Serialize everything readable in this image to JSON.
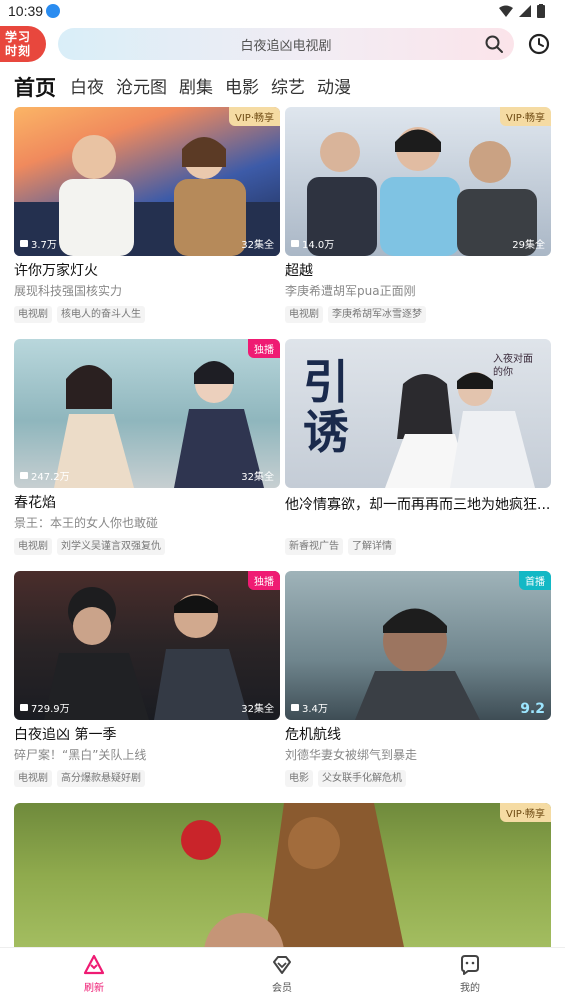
{
  "status_bar": {
    "time": "10:39"
  },
  "header": {
    "logo_line1": "学习",
    "logo_line2": "时刻",
    "search_placeholder": "白夜追凶电视剧"
  },
  "tabs": [
    "首页",
    "白夜",
    "沧元图",
    "剧集",
    "电影",
    "综艺",
    "动漫"
  ],
  "cards": [
    {
      "badge": "VIP·畅享",
      "badge_type": "vip",
      "views": "3.7万",
      "episodes": "32集全",
      "score": "",
      "title": "许你万家灯火",
      "subtitle": "展现科技强国核实力",
      "tags": [
        "电视剧",
        "核电人的奋斗人生"
      ]
    },
    {
      "badge": "VIP·畅享",
      "badge_type": "vip",
      "views": "14.0万",
      "episodes": "29集全",
      "score": "",
      "title": "超越",
      "subtitle": "李庚希遭胡军pua正面刚",
      "tags": [
        "电视剧",
        "李庚希胡军冰雪逐梦"
      ]
    },
    {
      "badge": "独播",
      "badge_type": "exclusive",
      "views": "247.2万",
      "episodes": "32集全",
      "score": "",
      "title": "春花焰",
      "subtitle": "景王：本王的女人你也敢碰",
      "tags": [
        "电视剧",
        "刘学义吴谨言双强复仇"
      ]
    },
    {
      "badge": "",
      "badge_type": "",
      "views": "",
      "episodes": "",
      "score": "",
      "title": "他冷情寡欲，却一而再再而三地为她疯狂......",
      "subtitle": "",
      "tags": [
        "新睿视广告",
        "了解详情"
      ],
      "overlay_big": "引诱",
      "overlay_small": "入夜对面的你"
    },
    {
      "badge": "独播",
      "badge_type": "exclusive",
      "views": "729.9万",
      "episodes": "32集全",
      "score": "",
      "title": "白夜追凶 第一季",
      "subtitle": "碎尸案！“黑白”关队上线",
      "tags": [
        "电视剧",
        "高分爆款悬疑好剧"
      ]
    },
    {
      "badge": "首播",
      "badge_type": "live",
      "views": "3.4万",
      "episodes": "",
      "score": "9.2",
      "title": "危机航线",
      "subtitle": "刘德华妻女被绑气到暴走",
      "tags": [
        "电影",
        "父女联手化解危机"
      ]
    }
  ],
  "big_card": {
    "badge": "VIP·畅享"
  },
  "bottom_nav": [
    {
      "label": "刷新",
      "icon": "refresh-triangle-icon",
      "active": true
    },
    {
      "label": "会员",
      "icon": "diamond-icon",
      "active": false
    },
    {
      "label": "我的",
      "icon": "profile-face-icon",
      "active": false
    }
  ],
  "colors": {
    "accent": "#ef1b73",
    "logo": "#e8473d",
    "vip_badge": "#f5dba3",
    "live_badge": "#13b8c5"
  }
}
